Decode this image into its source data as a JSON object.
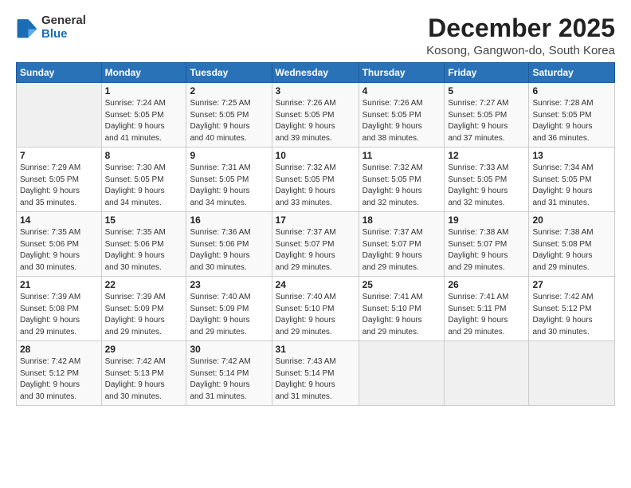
{
  "logo": {
    "line1": "General",
    "line2": "Blue"
  },
  "title": "December 2025",
  "subtitle": "Kosong, Gangwon-do, South Korea",
  "days_header": [
    "Sunday",
    "Monday",
    "Tuesday",
    "Wednesday",
    "Thursday",
    "Friday",
    "Saturday"
  ],
  "weeks": [
    [
      {
        "day": "",
        "info": ""
      },
      {
        "day": "1",
        "info": "Sunrise: 7:24 AM\nSunset: 5:05 PM\nDaylight: 9 hours\nand 41 minutes."
      },
      {
        "day": "2",
        "info": "Sunrise: 7:25 AM\nSunset: 5:05 PM\nDaylight: 9 hours\nand 40 minutes."
      },
      {
        "day": "3",
        "info": "Sunrise: 7:26 AM\nSunset: 5:05 PM\nDaylight: 9 hours\nand 39 minutes."
      },
      {
        "day": "4",
        "info": "Sunrise: 7:26 AM\nSunset: 5:05 PM\nDaylight: 9 hours\nand 38 minutes."
      },
      {
        "day": "5",
        "info": "Sunrise: 7:27 AM\nSunset: 5:05 PM\nDaylight: 9 hours\nand 37 minutes."
      },
      {
        "day": "6",
        "info": "Sunrise: 7:28 AM\nSunset: 5:05 PM\nDaylight: 9 hours\nand 36 minutes."
      }
    ],
    [
      {
        "day": "7",
        "info": "Sunrise: 7:29 AM\nSunset: 5:05 PM\nDaylight: 9 hours\nand 35 minutes."
      },
      {
        "day": "8",
        "info": "Sunrise: 7:30 AM\nSunset: 5:05 PM\nDaylight: 9 hours\nand 34 minutes."
      },
      {
        "day": "9",
        "info": "Sunrise: 7:31 AM\nSunset: 5:05 PM\nDaylight: 9 hours\nand 34 minutes."
      },
      {
        "day": "10",
        "info": "Sunrise: 7:32 AM\nSunset: 5:05 PM\nDaylight: 9 hours\nand 33 minutes."
      },
      {
        "day": "11",
        "info": "Sunrise: 7:32 AM\nSunset: 5:05 PM\nDaylight: 9 hours\nand 32 minutes."
      },
      {
        "day": "12",
        "info": "Sunrise: 7:33 AM\nSunset: 5:05 PM\nDaylight: 9 hours\nand 32 minutes."
      },
      {
        "day": "13",
        "info": "Sunrise: 7:34 AM\nSunset: 5:05 PM\nDaylight: 9 hours\nand 31 minutes."
      }
    ],
    [
      {
        "day": "14",
        "info": "Sunrise: 7:35 AM\nSunset: 5:06 PM\nDaylight: 9 hours\nand 30 minutes."
      },
      {
        "day": "15",
        "info": "Sunrise: 7:35 AM\nSunset: 5:06 PM\nDaylight: 9 hours\nand 30 minutes."
      },
      {
        "day": "16",
        "info": "Sunrise: 7:36 AM\nSunset: 5:06 PM\nDaylight: 9 hours\nand 30 minutes."
      },
      {
        "day": "17",
        "info": "Sunrise: 7:37 AM\nSunset: 5:07 PM\nDaylight: 9 hours\nand 29 minutes."
      },
      {
        "day": "18",
        "info": "Sunrise: 7:37 AM\nSunset: 5:07 PM\nDaylight: 9 hours\nand 29 minutes."
      },
      {
        "day": "19",
        "info": "Sunrise: 7:38 AM\nSunset: 5:07 PM\nDaylight: 9 hours\nand 29 minutes."
      },
      {
        "day": "20",
        "info": "Sunrise: 7:38 AM\nSunset: 5:08 PM\nDaylight: 9 hours\nand 29 minutes."
      }
    ],
    [
      {
        "day": "21",
        "info": "Sunrise: 7:39 AM\nSunset: 5:08 PM\nDaylight: 9 hours\nand 29 minutes."
      },
      {
        "day": "22",
        "info": "Sunrise: 7:39 AM\nSunset: 5:09 PM\nDaylight: 9 hours\nand 29 minutes."
      },
      {
        "day": "23",
        "info": "Sunrise: 7:40 AM\nSunset: 5:09 PM\nDaylight: 9 hours\nand 29 minutes."
      },
      {
        "day": "24",
        "info": "Sunrise: 7:40 AM\nSunset: 5:10 PM\nDaylight: 9 hours\nand 29 minutes."
      },
      {
        "day": "25",
        "info": "Sunrise: 7:41 AM\nSunset: 5:10 PM\nDaylight: 9 hours\nand 29 minutes."
      },
      {
        "day": "26",
        "info": "Sunrise: 7:41 AM\nSunset: 5:11 PM\nDaylight: 9 hours\nand 29 minutes."
      },
      {
        "day": "27",
        "info": "Sunrise: 7:42 AM\nSunset: 5:12 PM\nDaylight: 9 hours\nand 30 minutes."
      }
    ],
    [
      {
        "day": "28",
        "info": "Sunrise: 7:42 AM\nSunset: 5:12 PM\nDaylight: 9 hours\nand 30 minutes."
      },
      {
        "day": "29",
        "info": "Sunrise: 7:42 AM\nSunset: 5:13 PM\nDaylight: 9 hours\nand 30 minutes."
      },
      {
        "day": "30",
        "info": "Sunrise: 7:42 AM\nSunset: 5:14 PM\nDaylight: 9 hours\nand 31 minutes."
      },
      {
        "day": "31",
        "info": "Sunrise: 7:43 AM\nSunset: 5:14 PM\nDaylight: 9 hours\nand 31 minutes."
      },
      {
        "day": "",
        "info": ""
      },
      {
        "day": "",
        "info": ""
      },
      {
        "day": "",
        "info": ""
      }
    ]
  ]
}
